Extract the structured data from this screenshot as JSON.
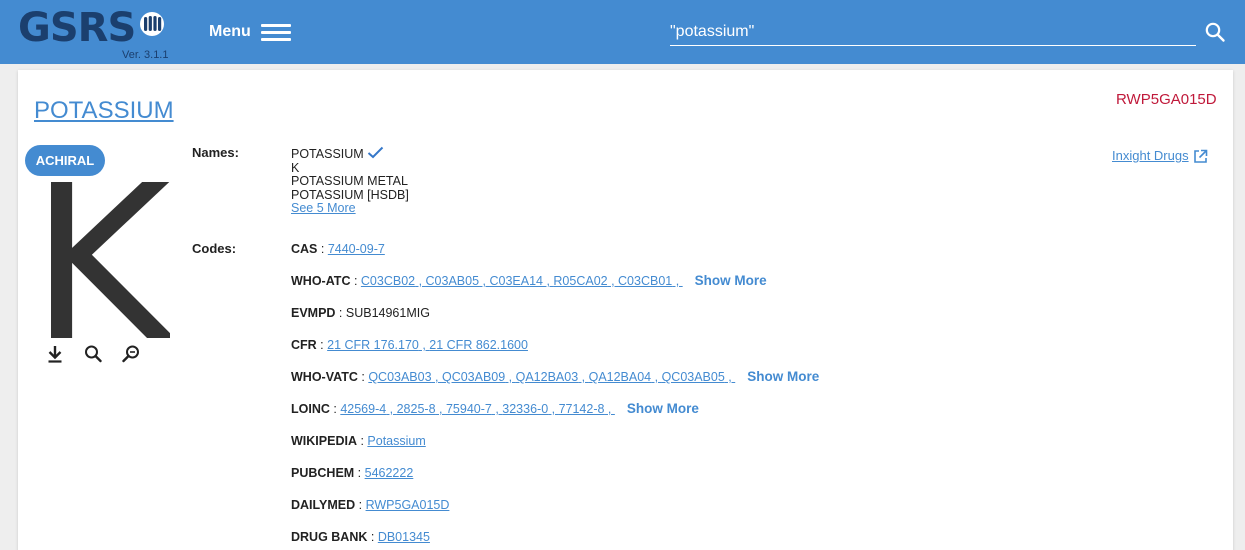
{
  "header": {
    "logo_text": "GSRS",
    "version": "Ver. 3.1.1",
    "menu_label": "Menu",
    "search_value": "\"potassium\""
  },
  "substance": {
    "name": "POTASSIUM",
    "approval_id": "RWP5GA015D",
    "stereo_badge": "ACHIRAL",
    "structure_symbol": "K",
    "external_link": "Inxight Drugs"
  },
  "names": {
    "label": "Names:",
    "items": [
      "POTASSIUM",
      "K",
      "POTASSIUM METAL",
      "POTASSIUM [HSDB]"
    ],
    "see_more": "See 5 More"
  },
  "codes": {
    "label": "Codes:",
    "sep": " : ",
    "show_more": "Show More",
    "rows": [
      {
        "key": "CAS",
        "values": [
          "7440-09-7"
        ],
        "show_more": false
      },
      {
        "key": "WHO-ATC",
        "values": [
          "C03CB02",
          "C03AB05",
          "C03EA14",
          "R05CA02",
          "C03CB01"
        ],
        "show_more": true
      },
      {
        "key": "EVMPD",
        "plain": "SUB14961MIG",
        "values": [],
        "show_more": false
      },
      {
        "key": "CFR",
        "values": [
          "21 CFR 176.170",
          "21 CFR 862.1600"
        ],
        "show_more": false
      },
      {
        "key": "WHO-VATC",
        "values": [
          "QC03AB03",
          "QC03AB09",
          "QA12BA03",
          "QA12BA04",
          "QC03AB05"
        ],
        "show_more": true
      },
      {
        "key": "LOINC",
        "values": [
          "42569-4",
          "2825-8",
          "75940-7",
          "32336-0",
          "77142-8"
        ],
        "show_more": true
      },
      {
        "key": "WIKIPEDIA",
        "values": [
          "Potassium"
        ],
        "show_more": false
      },
      {
        "key": "PUBCHEM",
        "values": [
          "5462222"
        ],
        "show_more": false
      },
      {
        "key": "DAILYMED",
        "values": [
          "RWP5GA015D"
        ],
        "show_more": false
      },
      {
        "key": "DRUG BANK",
        "values": [
          "DB01345"
        ],
        "show_more": false
      }
    ]
  },
  "colors": {
    "header_bg": "#448bd1",
    "logo": "#1b3f6e",
    "link": "#448bd1",
    "approval_id": "#c0193a"
  }
}
